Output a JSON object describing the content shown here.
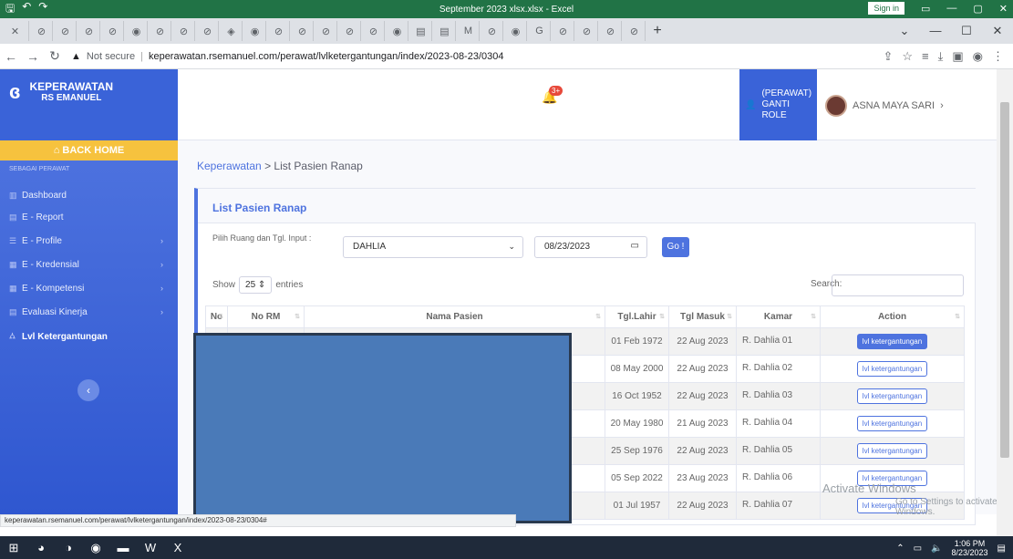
{
  "excel": {
    "title": "September 2023 xlsx.xlsx - Excel",
    "signin": "Sign in"
  },
  "browser": {
    "not_secure": "Not secure",
    "url": "keperawatan.rsemanuel.com/perawat/lvlketergantungan/index/2023-08-23/0304",
    "status_url": "keperawatan.rsemanuel.com/perawat/lvlketergantungan/index/2023-08-23/0304#"
  },
  "header": {
    "brand_line1": "KEPERAWATAN",
    "brand_line2": "RS EMANUEL",
    "notif_count": "3+",
    "role_line1": "(PERAWAT)",
    "role_line2": "GANTI ROLE",
    "user_name": "ASNA MAYA SARI"
  },
  "sidebar": {
    "back_home": "BACK HOME",
    "heading": "SEBAGAI PERAWAT",
    "items": [
      {
        "label": "Dashboard"
      },
      {
        "label": "E - Report"
      },
      {
        "label": "E - Profile"
      },
      {
        "label": "E - Kredensial"
      },
      {
        "label": "E - Kompetensi"
      },
      {
        "label": "Evaluasi Kinerja"
      },
      {
        "label": "Lvl Ketergantungan"
      }
    ]
  },
  "breadcrumb": {
    "root": "Keperawatan",
    "current": "List Pasien Ranap"
  },
  "card": {
    "title": "List Pasien Ranap",
    "filter_label": "Pilih Ruang dan Tgl. Input :",
    "ruang_value": "DAHLIA",
    "date_value": "08/23/2023",
    "go_label": "Go !",
    "show_label": "Show",
    "entries_value": "25",
    "entries_label": "entries",
    "search_label": "Search:"
  },
  "table": {
    "headers": [
      "No",
      "No RM",
      "Nama Pasien",
      "Tgl.Lahir",
      "Tgl Masuk",
      "Kamar",
      "Action"
    ],
    "rows": [
      {
        "lahir": "01 Feb 1972",
        "masuk": "22 Aug 2023",
        "kamar": "R. Dahlia 01",
        "action": "lvl ketergantungan"
      },
      {
        "lahir": "08 May 2000",
        "masuk": "22 Aug 2023",
        "kamar": "R. Dahlia 02",
        "action": "lvl ketergantungan"
      },
      {
        "lahir": "16 Oct 1952",
        "masuk": "22 Aug 2023",
        "kamar": "R. Dahlia 03",
        "action": "lvl ketergantungan"
      },
      {
        "lahir": "20 May 1980",
        "masuk": "21 Aug 2023",
        "kamar": "R. Dahlia 04",
        "action": "lvl ketergantungan"
      },
      {
        "lahir": "25 Sep 1976",
        "masuk": "22 Aug 2023",
        "kamar": "R. Dahlia 05",
        "action": "lvl ketergantungan"
      },
      {
        "lahir": "05 Sep 2022",
        "masuk": "23 Aug 2023",
        "kamar": "R. Dahlia 06",
        "action": "lvl ketergantungan"
      },
      {
        "lahir": "01 Jul 1957",
        "masuk": "22 Aug 2023",
        "kamar": "R. Dahlia 07",
        "action": "lvl ketergantungan"
      }
    ]
  },
  "watermark": {
    "line1": "Activate Windows",
    "line2": "Go to Settings to activate Windows."
  },
  "taskbar": {
    "time": "1:06 PM",
    "date": "8/23/2023"
  },
  "colors": {
    "primary": "#4e73df",
    "warning": "#f6c23e",
    "excel_green": "#217346"
  }
}
